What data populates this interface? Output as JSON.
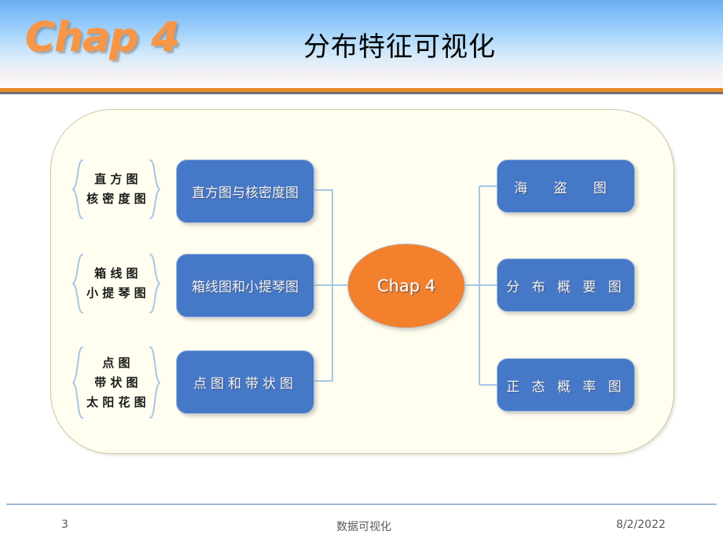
{
  "header": {
    "logo": "Chap 4",
    "title": "分布特征可视化",
    "accent_orange": "#E98A28",
    "rule_gray": "#6F6F6F"
  },
  "diagram": {
    "center": {
      "label": "Chap 4",
      "color": "#F2802C"
    },
    "box_color": "#4678C8",
    "panel_color": "#FFFEF0",
    "connector_color": "#A8C6E8",
    "left_groups": [
      {
        "brace_items": [
          "直  方  图",
          "核 密 度 图"
        ],
        "box_label": "直方图与核密度图"
      },
      {
        "brace_items": [
          "箱  线  图",
          "小 提 琴 图"
        ],
        "box_label": "箱线图和小提琴图"
      },
      {
        "brace_items": [
          "点        图",
          "带  状  图",
          "太 阳 花 图"
        ],
        "box_label": "点图和带状图"
      }
    ],
    "right_boxes": [
      {
        "box_label": "海 盗 图"
      },
      {
        "box_label": "分 布 概 要 图"
      },
      {
        "box_label": "正 态 概 率 图"
      }
    ]
  },
  "footer": {
    "page_number": "3",
    "center_text": "数据可视化",
    "date": "8/2/2022"
  }
}
